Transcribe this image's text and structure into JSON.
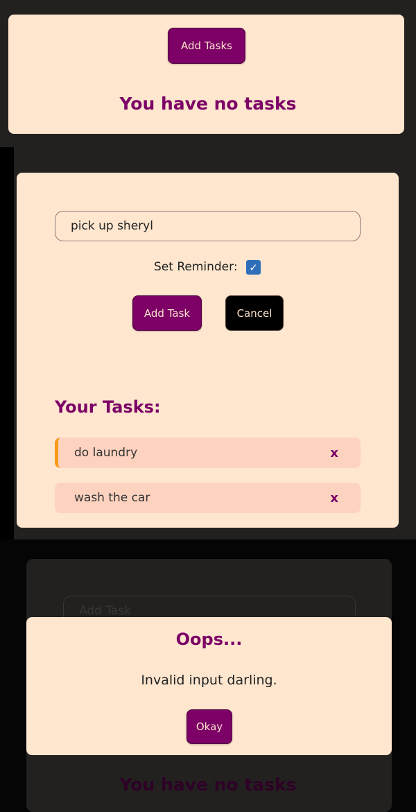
{
  "screen1": {
    "add_tasks_button": "Add Tasks",
    "empty_message": "You have no tasks"
  },
  "screen2": {
    "task_input_value": "pick up sheryl",
    "reminder_label": "Set Reminder:",
    "reminder_checked": true,
    "add_task_button": "Add Task",
    "cancel_button": "Cancel",
    "tasks_heading": "Your Tasks:",
    "tasks": [
      {
        "text": "do laundry",
        "reminder": true,
        "delete_label": "x"
      },
      {
        "text": "wash the car",
        "reminder": false,
        "delete_label": "x"
      }
    ]
  },
  "screen3": {
    "input_placeholder": "Add Task",
    "empty_message": "You have no tasks",
    "dialog": {
      "title": "Oops...",
      "message": "Invalid input darling.",
      "okay_button": "Okay"
    }
  },
  "colors": {
    "accent": "#7c0066",
    "card_bg": "#fee6cf",
    "task_bg": "#fdd3c0",
    "reminder_border": "#f79a1b",
    "page_bg": "#222120"
  }
}
